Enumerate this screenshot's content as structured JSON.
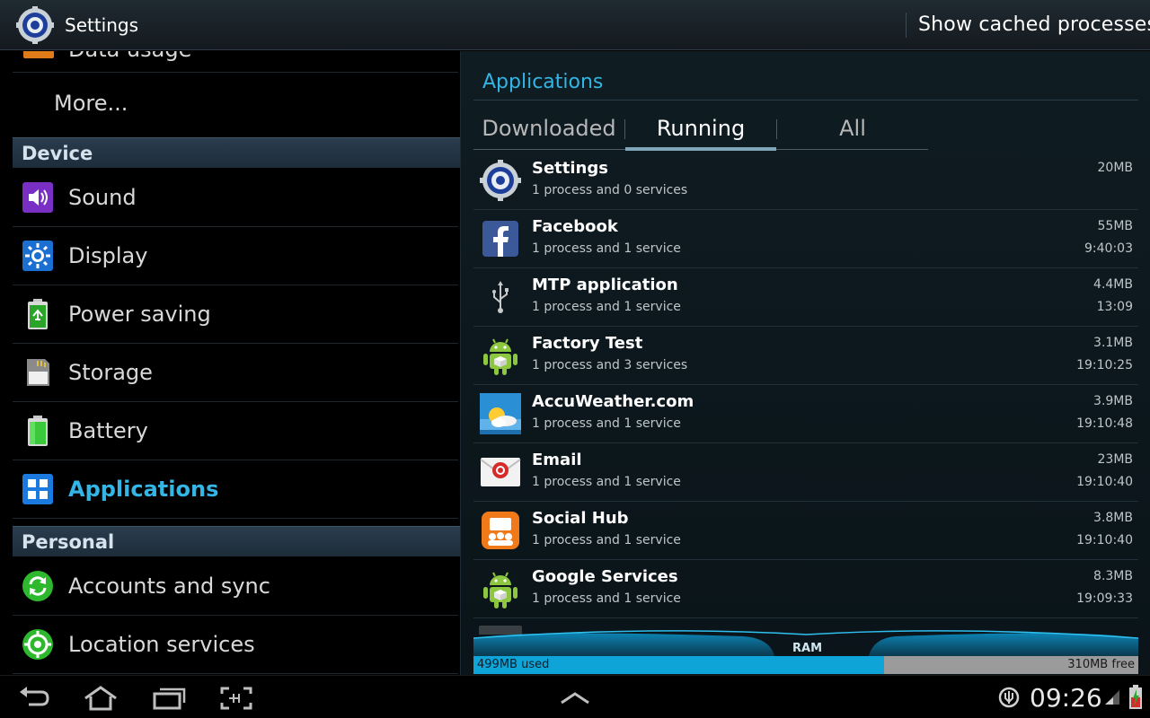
{
  "action_bar": {
    "title": "Settings",
    "cached_button": "Show cached processes"
  },
  "left": {
    "partial_item": "Data usage",
    "more_label": "More...",
    "device_header": "Device",
    "personal_header": "Personal",
    "device_items": [
      {
        "label": "Sound",
        "icon": "sound-icon"
      },
      {
        "label": "Display",
        "icon": "display-icon"
      },
      {
        "label": "Power saving",
        "icon": "power-saving-icon"
      },
      {
        "label": "Storage",
        "icon": "storage-icon"
      },
      {
        "label": "Battery",
        "icon": "battery-icon"
      },
      {
        "label": "Applications",
        "icon": "applications-icon",
        "selected": true
      }
    ],
    "personal_items": [
      {
        "label": "Accounts and sync",
        "icon": "sync-icon"
      },
      {
        "label": "Location services",
        "icon": "location-icon"
      }
    ]
  },
  "right": {
    "title": "Applications",
    "tabs": [
      "Downloaded",
      "Running",
      "All"
    ],
    "active_tab": "Running",
    "processes": [
      {
        "name": "Settings",
        "sub": "1 process and 0 services",
        "size": "20MB",
        "time": "",
        "icon": "settings-gear-icon"
      },
      {
        "name": "Facebook",
        "sub": "1 process and 1 service",
        "size": "55MB",
        "time": "9:40:03",
        "icon": "facebook-icon"
      },
      {
        "name": "MTP application",
        "sub": "1 process and 1 service",
        "size": "4.4MB",
        "time": "13:09",
        "icon": "usb-icon"
      },
      {
        "name": "Factory Test",
        "sub": "1 process and 3 services",
        "size": "3.1MB",
        "time": "19:10:25",
        "icon": "android-icon"
      },
      {
        "name": "AccuWeather.com",
        "sub": "1 process and 1 service",
        "size": "3.9MB",
        "time": "19:10:48",
        "icon": "accuweather-icon"
      },
      {
        "name": "Email",
        "sub": "1 process and 1 service",
        "size": "23MB",
        "time": "19:10:40",
        "icon": "email-icon"
      },
      {
        "name": "Social Hub",
        "sub": "1 process and 1 service",
        "size": "3.8MB",
        "time": "19:10:40",
        "icon": "social-hub-icon"
      },
      {
        "name": "Google Services",
        "sub": "1 process and 1 service",
        "size": "8.3MB",
        "time": "19:09:33",
        "icon": "android-icon"
      }
    ],
    "ram": {
      "label": "RAM",
      "used": "499MB used",
      "free": "310MB free",
      "used_fraction": 0.617
    }
  },
  "system_bar": {
    "clock": "09:26"
  },
  "colors": {
    "accent": "#33b5e5",
    "ram_used": "#0fa4d8",
    "ram_free": "#9b9b9b"
  }
}
